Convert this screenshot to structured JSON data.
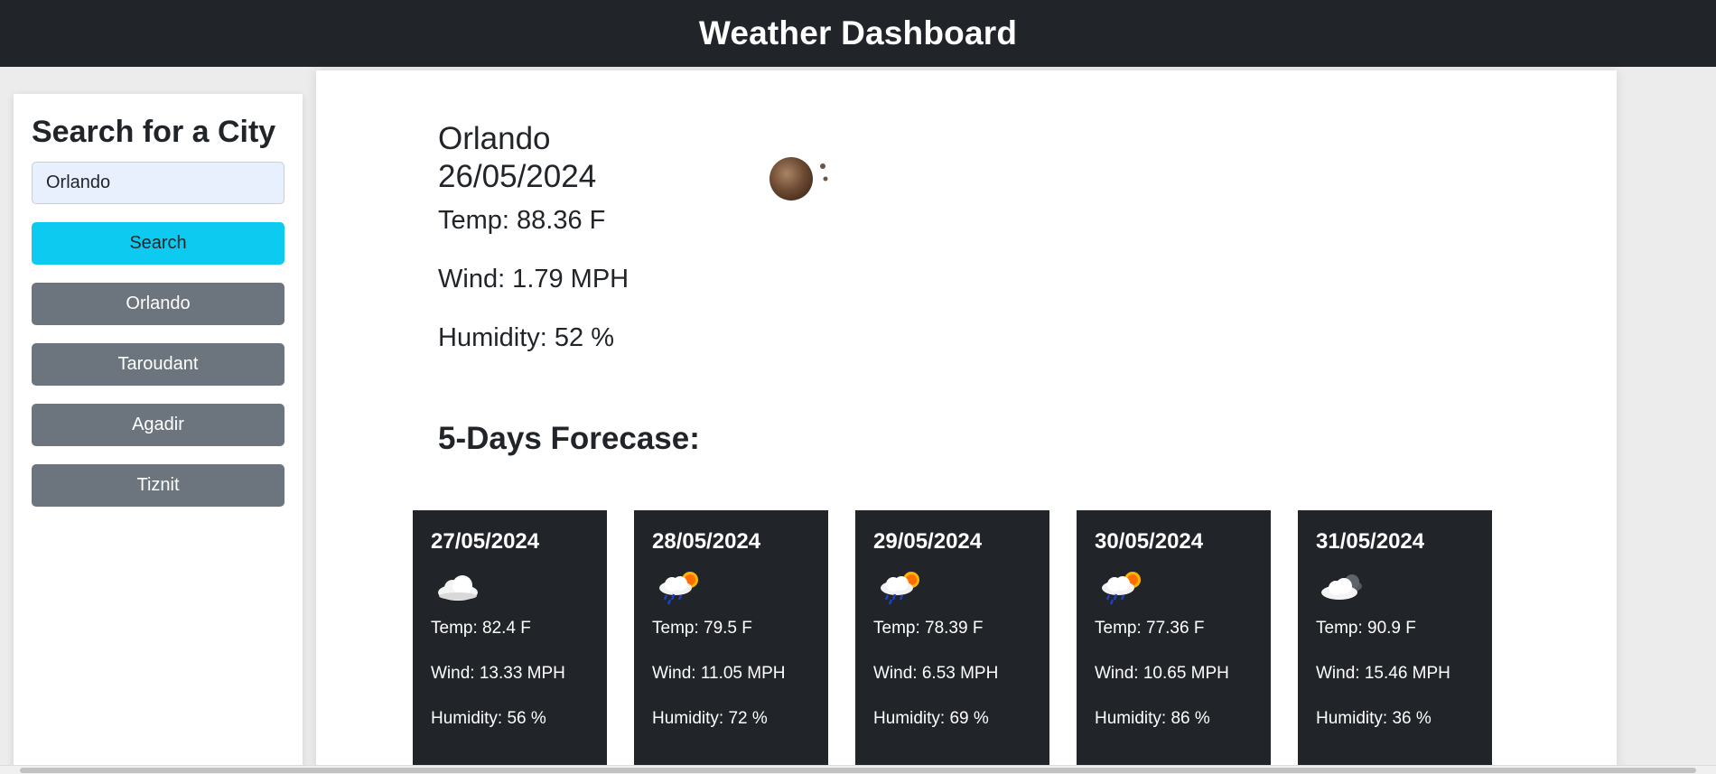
{
  "header": {
    "title": "Weather Dashboard"
  },
  "sidebar": {
    "title": "Search for a City",
    "search_value": "Orlando",
    "search_placeholder": "",
    "search_button": "Search",
    "history": [
      "Orlando",
      "Taroudant",
      "Agadir",
      "Tiznit"
    ]
  },
  "current": {
    "city": "Orlando",
    "date": "26/05/2024",
    "temp": "Temp: 88.36 F",
    "wind": "Wind: 1.79 MPH",
    "humidity": "Humidity: 52 %",
    "icon": "clear-night-icon"
  },
  "forecast": {
    "title": "5-Days Forecase:",
    "days": [
      {
        "date": "27/05/2024",
        "icon": "cloud-icon",
        "temp": "Temp: 82.4 F",
        "wind": "Wind: 13.33 MPH",
        "humidity": "Humidity: 56 %"
      },
      {
        "date": "28/05/2024",
        "icon": "sun-rain-icon",
        "temp": "Temp: 79.5 F",
        "wind": "Wind: 11.05 MPH",
        "humidity": "Humidity: 72 %"
      },
      {
        "date": "29/05/2024",
        "icon": "sun-rain-icon",
        "temp": "Temp: 78.39 F",
        "wind": "Wind: 6.53 MPH",
        "humidity": "Humidity: 69 %"
      },
      {
        "date": "30/05/2024",
        "icon": "sun-rain-icon",
        "temp": "Temp: 77.36 F",
        "wind": "Wind: 10.65 MPH",
        "humidity": "Humidity: 86 %"
      },
      {
        "date": "31/05/2024",
        "icon": "broken-clouds-icon",
        "temp": "Temp: 90.9 F",
        "wind": "Wind: 15.46 MPH",
        "humidity": "Humidity: 36 %"
      }
    ]
  },
  "colors": {
    "header_bg": "#212529",
    "search_button": "#0dcaf0",
    "history_button": "#6c757d",
    "card_bg": "#212529"
  }
}
